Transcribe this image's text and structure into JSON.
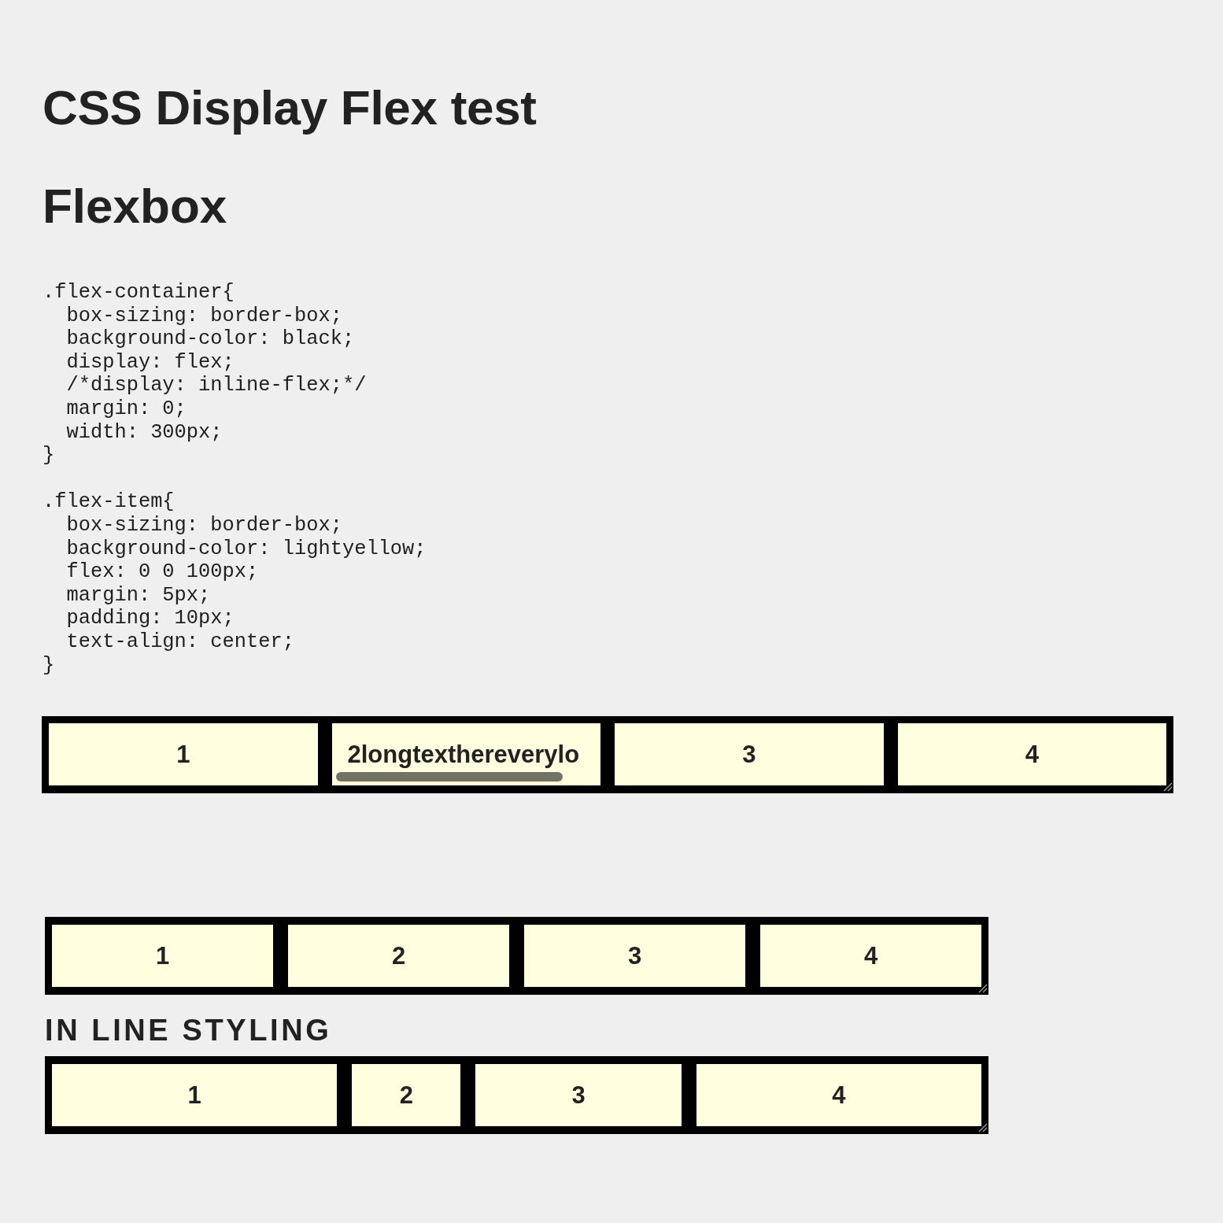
{
  "title": "CSS Display Flex test",
  "heading": "Flexbox",
  "code": ".flex-container{\n  box-sizing: border-box;\n  background-color: black;\n  display: flex;\n  /*display: inline-flex;*/\n  margin: 0;\n  width: 300px;\n}\n\n.flex-item{\n  box-sizing: border-box;\n  background-color: lightyellow;\n  flex: 0 0 100px;\n  margin: 5px;\n  padding: 10px;\n  text-align: center;\n}",
  "demos": [
    {
      "resizable": true,
      "items": [
        {
          "kind": "plain",
          "label": "1"
        },
        {
          "kind": "overflow",
          "label": "2longtexthereverylo"
        },
        {
          "kind": "plain",
          "label": "3"
        },
        {
          "kind": "plain",
          "label": "4"
        }
      ]
    },
    {
      "resizable": true,
      "items": [
        {
          "kind": "plain",
          "label": "1"
        },
        {
          "kind": "plain",
          "label": "2"
        },
        {
          "kind": "plain",
          "label": "3"
        },
        {
          "kind": "plain",
          "label": "4"
        }
      ]
    },
    {
      "caption": "IN LINE STYLING",
      "resizable": true,
      "items": [
        {
          "kind": "plain",
          "label": "1"
        },
        {
          "kind": "plain",
          "label": "2"
        },
        {
          "kind": "plain",
          "label": "3"
        },
        {
          "kind": "plain",
          "label": "4"
        }
      ]
    }
  ]
}
